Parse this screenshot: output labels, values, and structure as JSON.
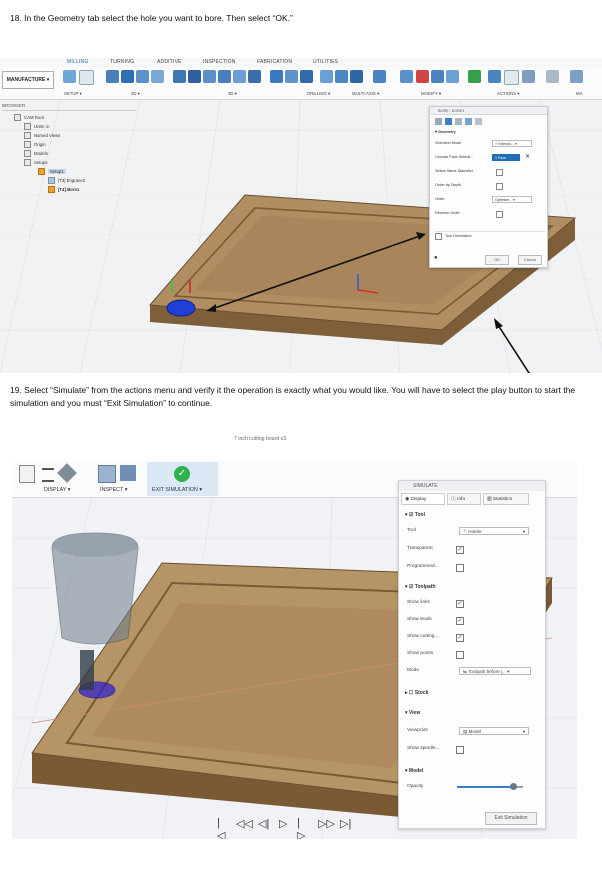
{
  "step18": {
    "text": "18. In the Geometry tab select the hole you want to bore. Then select “OK.”"
  },
  "step19": {
    "text": "19. Select “Simulate” from the actions menu and verify it the operation is exactly what you would like. You will have to select the play button to start the simulation and you must “Exit Simulation” to continue."
  },
  "shot1": {
    "tabs": [
      "MILLING",
      "TURNING",
      "ADDITIVE",
      "INSPECTION",
      "FABRICATION",
      "UTILITIES"
    ],
    "manufacture": "MANUFACTURE ▾",
    "groups": [
      "SETUP ▾",
      "2D ▾",
      "3D ▾",
      "DRILLING ▾",
      "MULTI-AXIS ▾",
      "MODIFY ▾",
      "ACTIONS ▾",
      "MA"
    ],
    "browser": {
      "title": "BROWSER",
      "items": [
        "CAM Root",
        "Units: in",
        "Named Views",
        "Origin",
        "Models",
        "Setups",
        "Setup1",
        "[T3] Engrave2",
        "[T4] Bore1"
      ]
    },
    "dialog": {
      "title": "BORE : BORE1",
      "section": "Geometry",
      "rows": [
        {
          "label": "Selection Mode",
          "value": "Selectio..."
        },
        {
          "label": "Circular Face Selecti...",
          "value": "1 Face"
        },
        {
          "label": "Select Same Diameter",
          "value": ""
        },
        {
          "label": "Order by Depth",
          "value": ""
        },
        {
          "label": "Order",
          "value": "Optimize..."
        },
        {
          "label": "Reverse Order",
          "value": ""
        }
      ],
      "tool_orientation": "Tool Orientation",
      "ok": "OK",
      "cancel": "Cancel"
    }
  },
  "shot2": {
    "doc_title": "7 inch cutting board v3",
    "ribbon": {
      "display": "DISPLAY ▾",
      "inspect": "INSPECT ▾",
      "exit": "EXIT SIMULATION ▾"
    },
    "panel": {
      "title": "SIMULATE",
      "tabs": [
        "Display",
        "Info",
        "Statistics"
      ],
      "tool": {
        "section": "Tool",
        "tool_label": "Tool",
        "tool_value": "Holder",
        "transparent": "Transparent",
        "programmed": "Programmed..."
      },
      "toolpath": {
        "section": "Toolpath",
        "links": "Show links",
        "leads": "Show leads",
        "cutting": "Show cutting...",
        "points": "Show points",
        "mode": "Mode",
        "mode_value": "Toolpath before j..."
      },
      "stock": "Stock",
      "view": {
        "section": "View",
        "viewpoint": "Viewpoint",
        "viewpoint_value": "Model",
        "spindle": "Show spindle..."
      },
      "model": {
        "section": "Model",
        "opacity": "Opacity",
        "opacity_level": 0.85
      },
      "exit_button": "Exit Simulation"
    }
  },
  "colors": {
    "accent": "#1f6fb5",
    "wood": "#a9865a",
    "green": "#2fb24a",
    "hole_blue": "#1f3fd6"
  }
}
